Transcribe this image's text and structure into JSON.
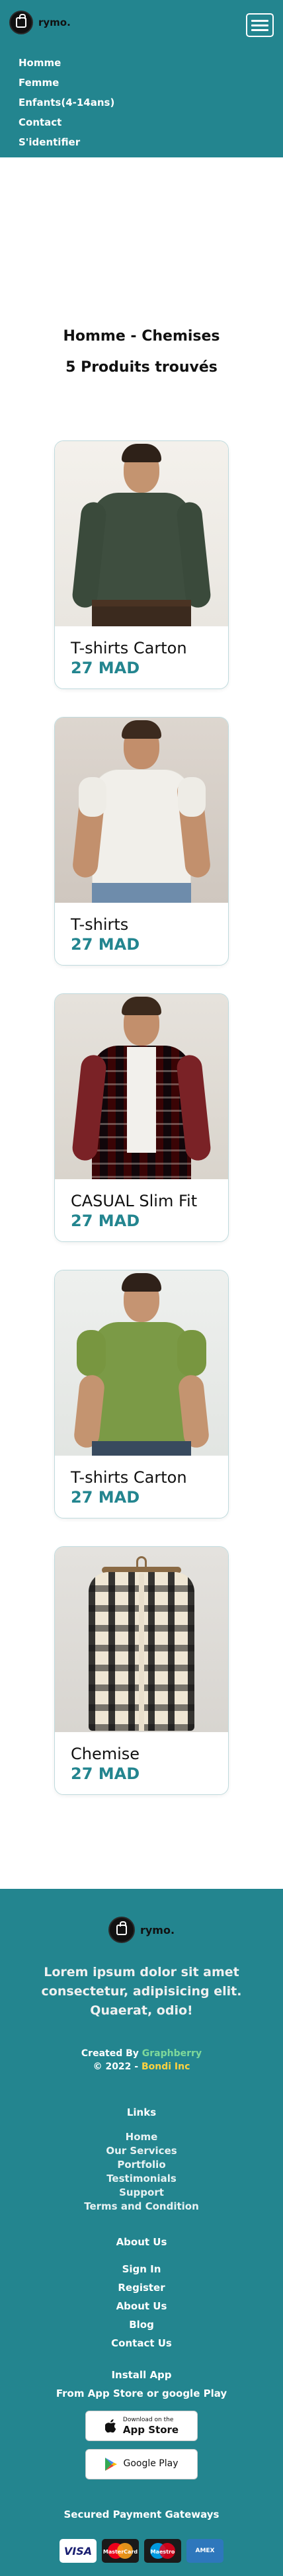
{
  "header": {
    "logo_text": "rymo.",
    "nav": [
      "Homme",
      "Femme",
      "Enfants(4-14ans)",
      "Contact",
      "S'identifier"
    ]
  },
  "main": {
    "title": "Homme - Chemises",
    "result_count": "5 Produits trouvés",
    "products": [
      {
        "name": "T-shirts Carton",
        "price": "27 MAD",
        "image": "green-dark-shirt"
      },
      {
        "name": "T-shirts",
        "price": "27 MAD",
        "image": "white-short-sleeve-shirt"
      },
      {
        "name": "CASUAL Slim Fit",
        "price": "27 MAD",
        "image": "red-navy-plaid-shirt"
      },
      {
        "name": "T-shirts Carton",
        "price": "27 MAD",
        "image": "olive-green-short-sleeve-shirt"
      },
      {
        "name": "Chemise",
        "price": "27 MAD",
        "image": "beige-black-plaid-shirt-on-hanger"
      }
    ]
  },
  "footer": {
    "logo_text": "rymo.",
    "tagline": "Lorem ipsum dolor sit amet consectetur, adipisicing elit. Quaerat, odio!",
    "created_by_prefix": "Created By ",
    "created_by_name": "Graphberry",
    "copyright_prefix": "© 2022 - ",
    "copyright_name": "Bondi Inc",
    "links_heading": "Links",
    "links": [
      "Home",
      "Our Services",
      "Portfolio",
      "Testimonials",
      "Support",
      "Terms and Condition"
    ],
    "about_heading": "About Us",
    "about_links": [
      "Sign In",
      "Register",
      "About Us",
      "Blog",
      "Contact Us"
    ],
    "install_title": "Install App",
    "install_subtitle": "From App Store or google Play",
    "app_store_small": "Download on the",
    "app_store_big": "App Store",
    "google_play": "Google Play",
    "secure_heading": "Secured Payment Gateways",
    "payments": [
      "VISA",
      "MasterCard",
      "Maestro",
      "AMEX"
    ]
  },
  "colors": {
    "brand": "#23858f",
    "price": "#23858f",
    "credit_link": "#7fd99a",
    "credit_company": "#ffd23f"
  }
}
